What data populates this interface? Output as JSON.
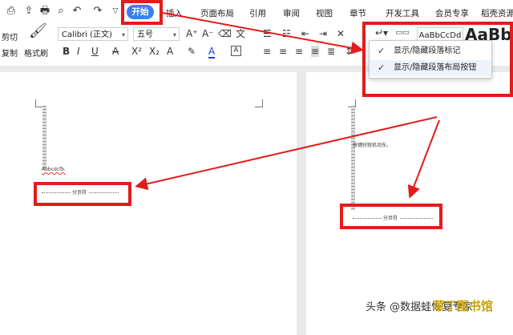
{
  "ribbon": {
    "tabs": [
      "开始",
      "插入",
      "页面布局",
      "引用",
      "审阅",
      "视图",
      "章节",
      "开发工具",
      "会员专享",
      "稻壳资源"
    ],
    "cut_label": "剪切",
    "copy_label": "复制",
    "format_painter_label": "格式刷",
    "font_name": "Calibri (正文)",
    "font_size": "五号",
    "style1": "AaBbCcDd",
    "style2": "AaBb",
    "style2_tail": "A"
  },
  "paragraph_menu": {
    "items": [
      "显示/隐藏段落标记",
      "显示/隐藏段落布局按钮"
    ]
  },
  "document": {
    "left_page": {
      "line1": "Abbcdcfb.",
      "footer_text": "分页符"
    },
    "right_page": {
      "line1": "按键好就机动东。",
      "footer_text": "分页符"
    }
  },
  "watermark": {
    "prefix": "头条 @数据蛙恢复专家",
    "brand": "草丁图书馆"
  },
  "colors": {
    "accent": "#3a7ff2",
    "annotation": "#e31b1b"
  }
}
